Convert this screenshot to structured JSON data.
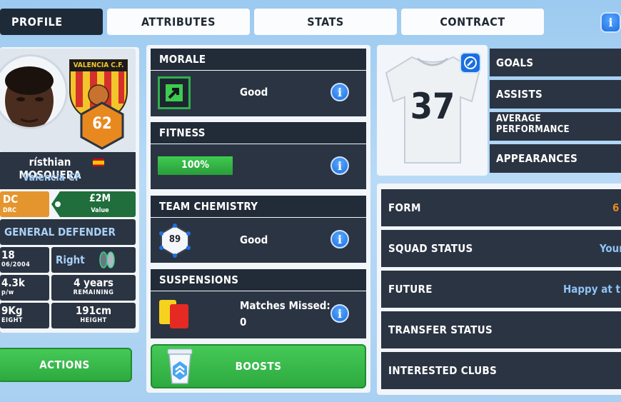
{
  "tabs": {
    "profile": "PROFILE",
    "attributes": "ATTRIBUTES",
    "stats": "STATS",
    "contract": "CONTRACT"
  },
  "player": {
    "name": "rísthian MOSQUERA",
    "club": "Valencia CF",
    "badge_text": "VALENCIA C.F.",
    "rating": "62",
    "position_short": "DC",
    "position_sub": "DRC",
    "value": "£2M",
    "value_label": "Value",
    "role": "GENERAL DEFENDER",
    "age": "18",
    "dob": "06/2004",
    "foot": "Right",
    "wage": "4.3k",
    "wage_label": "p/w",
    "contract_years": "4 years",
    "contract_label": "REMAINING",
    "weight": "9Kg",
    "weight_label": "EIGHT",
    "height": "191cm",
    "height_label": "HEIGHT",
    "shirt_number": "37"
  },
  "buttons": {
    "actions": "ACTIONS",
    "boosts": "BOOSTS",
    "info": "i"
  },
  "morale": {
    "title": "MORALE",
    "value": "Good"
  },
  "fitness": {
    "title": "FITNESS",
    "value": "100%",
    "level": 1.0
  },
  "chemistry": {
    "title": "TEAM CHEMISTRY",
    "score": "89",
    "value": "Good"
  },
  "suspensions": {
    "title": "SUSPENSIONS",
    "label": "Matches Missed:",
    "count": "0"
  },
  "stats_summary": {
    "goals": "GOALS",
    "assists": "ASSISTS",
    "avg_line1": "AVERAGE",
    "avg_line2": "PERFORMANCE",
    "appearances": "APPEARANCES"
  },
  "details": {
    "form_label": "FORM",
    "form_value": "6",
    "squad_label": "SQUAD STATUS",
    "squad_value": "Your",
    "future_label": "FUTURE",
    "future_value": "Happy at the",
    "transfer_label": "TRANSFER STATUS",
    "interested_label": "INTERESTED CLUBS"
  },
  "colors": {
    "accent_orange": "#e8891f",
    "value_green": "#1f6e3b",
    "dark_panel": "#2b3442",
    "info_blue": "#1a6fe0",
    "fitness_green": "#2fb04a"
  }
}
